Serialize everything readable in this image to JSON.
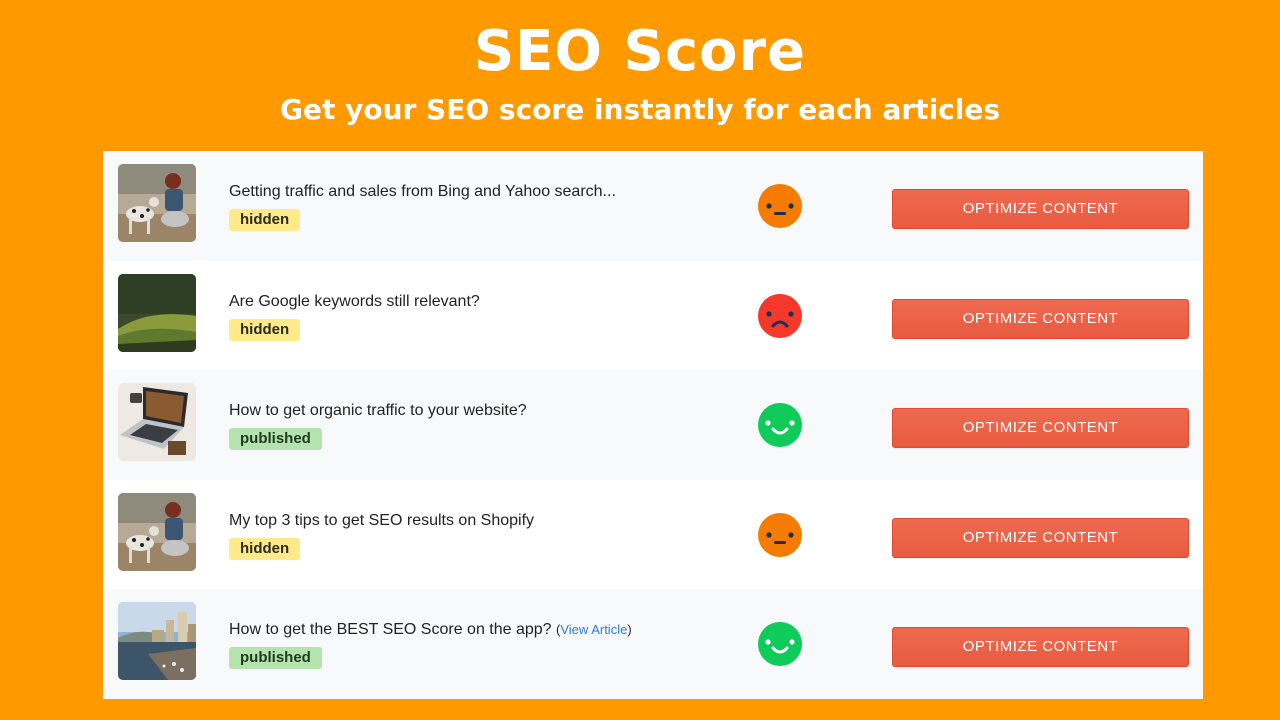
{
  "header": {
    "title": "SEO Score",
    "subtitle": "Get your SEO score instantly for each articles"
  },
  "colors": {
    "background": "#ff9900",
    "button": "#eb6148",
    "badge_hidden": "#ffea8a",
    "badge_published": "#b5e3b0",
    "score_neutral": "#f57c00",
    "score_bad": "#f4392b",
    "score_good": "#0fcc5a",
    "link": "#2f7bcf"
  },
  "articles": [
    {
      "title": "Getting traffic and sales from Bing and Yahoo search...",
      "status": "hidden",
      "score": "neutral",
      "score_icon": "neutral-face-icon",
      "thumbnail": "woman-with-dog-image",
      "button_label": "OPTIMIZE CONTENT"
    },
    {
      "title": "Are Google keywords still relevant?",
      "status": "hidden",
      "score": "bad",
      "score_icon": "sad-face-icon",
      "thumbnail": "forest-hillside-image",
      "button_label": "OPTIMIZE CONTENT"
    },
    {
      "title": "How to get organic traffic to your website?",
      "status": "published",
      "score": "good",
      "score_icon": "happy-face-icon",
      "thumbnail": "laptop-desk-image",
      "button_label": "OPTIMIZE CONTENT"
    },
    {
      "title": "My top 3 tips to get SEO results on Shopify",
      "status": "hidden",
      "score": "neutral",
      "score_icon": "neutral-face-icon",
      "thumbnail": "woman-with-dog-image",
      "button_label": "OPTIMIZE CONTENT"
    },
    {
      "title": "How to get the BEST SEO Score on the app?",
      "link_open": "(",
      "link_label": "View Article",
      "link_close": ")",
      "status": "published",
      "score": "good",
      "score_icon": "happy-face-icon",
      "thumbnail": "city-waterfront-image",
      "button_label": "OPTIMIZE CONTENT"
    }
  ]
}
